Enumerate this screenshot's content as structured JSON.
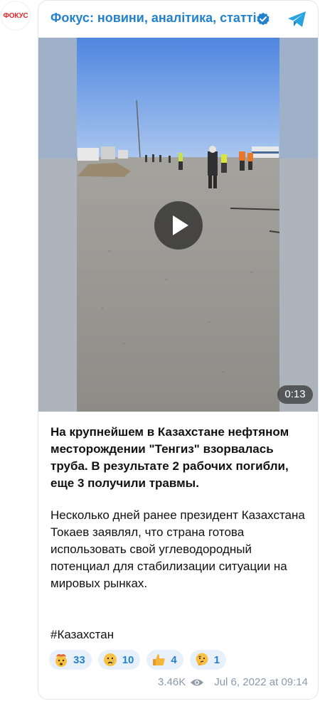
{
  "channel": {
    "avatar_text": "ФОКУС",
    "title": "Фокус: новини, аналітика, статті",
    "brand_color": "#2481cc",
    "avatar_color": "#e0252a"
  },
  "video": {
    "duration": "0:13",
    "play_icon": "play-icon"
  },
  "post": {
    "paragraph1": "На крупнейшем в Казахстане нефтяном месторождении \"Тенгиз\" взорвалась труба. В результате 2 рабочих погибли, еще 3 получили травмы.",
    "paragraph2": "Несколько дней ранее президент Казахстана Токаев заявлял, что страна готова использовать свой углеводородный потенциал для стабилизации ситуации на мировых рынках.",
    "hashtag": "#Казахстан"
  },
  "reactions": [
    {
      "emoji": "exploding-head-emoji",
      "count": "33"
    },
    {
      "emoji": "crying-face-emoji",
      "count": "10"
    },
    {
      "emoji": "thumbs-up-emoji",
      "count": "4"
    },
    {
      "emoji": "thinking-face-emoji",
      "count": "1"
    }
  ],
  "meta": {
    "views": "3.46K",
    "date": "Jul 6, 2022 at 09:14"
  }
}
